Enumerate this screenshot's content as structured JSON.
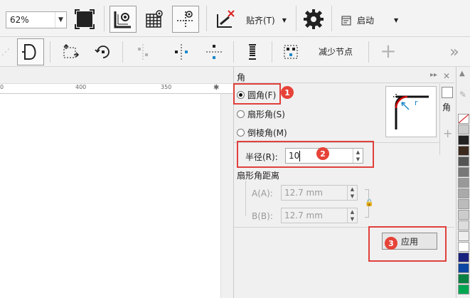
{
  "toolbar1": {
    "zoom_value": "62%",
    "snap_label": "贴齐(T)",
    "launch_label": "启动"
  },
  "toolbar2": {
    "reduce_nodes_label": "减少节点"
  },
  "ruler": {
    "ticks": [
      "0",
      "400",
      "350"
    ]
  },
  "docker": {
    "title": "角",
    "corner_types": [
      {
        "label": "圆角(F)",
        "selected": true
      },
      {
        "label": "扇形角(S)",
        "selected": false
      },
      {
        "label": "倒棱角(M)",
        "selected": false
      }
    ],
    "radius_label": "半径(R):",
    "radius_value": "10",
    "scallop_distance_label": "扇形角距离",
    "a_label": "A(A):",
    "a_value": "12.7 mm",
    "b_label": "B(B):",
    "b_value": "12.7 mm",
    "apply_label": "应用",
    "preview_r": "r"
  },
  "annotations": {
    "badge1": "1",
    "badge2": "2",
    "badge3": "3",
    "highlight_color": "#e0403c"
  },
  "palette_colors": [
    "#ffffff",
    "#cccccc",
    "#222222",
    "#3c2a1e",
    "#555555",
    "#777777",
    "#999999",
    "#aaaaaa",
    "#bbbbbb",
    "#cccccc",
    "#dddddd",
    "#eeeeee",
    "#ffffff",
    "#1a237e",
    "#0d47a1",
    "#0b8043",
    "#00a651"
  ]
}
